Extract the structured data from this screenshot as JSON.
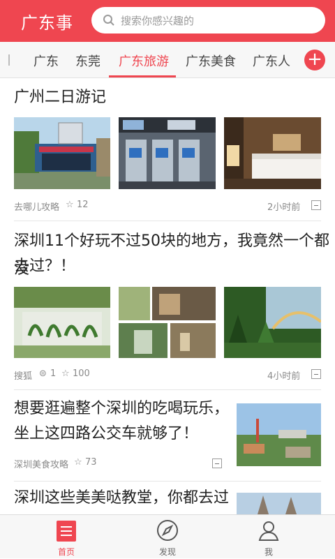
{
  "header": {
    "brand": "广东事",
    "search_placeholder": "搜索你感兴趣的"
  },
  "tabs": [
    {
      "label": "广东"
    },
    {
      "label": "东莞"
    },
    {
      "label": "广东旅游",
      "active": true
    },
    {
      "label": "广东美食"
    },
    {
      "label": "广东人"
    }
  ],
  "add_tab_label": "+",
  "articles": [
    {
      "title": "广州二日游记",
      "source": "去哪儿攻略",
      "stars": "12",
      "time": "2小时前"
    },
    {
      "title_line1": "深圳11个好玩不过50块的地方，我竟然一个都没",
      "title_line2": "去过？！",
      "source": "搜狐",
      "comments": "1",
      "stars": "100",
      "time": "4小时前"
    },
    {
      "title_line1": "想要逛遍整个深圳的吃喝玩乐，",
      "title_line2": "坐上这四路公交车就够了！",
      "source": "深圳美食攻略",
      "stars": "73"
    },
    {
      "title_line1": "深圳这些美美哒教堂，你都去过"
    }
  ],
  "bottom_nav": [
    {
      "label": "首页",
      "icon": "list-icon",
      "active": true
    },
    {
      "label": "发现",
      "icon": "compass-icon"
    },
    {
      "label": "我",
      "icon": "person-icon"
    }
  ],
  "colors": {
    "accent": "#ef4650",
    "text": "#222222",
    "meta": "#8a8a8a"
  }
}
